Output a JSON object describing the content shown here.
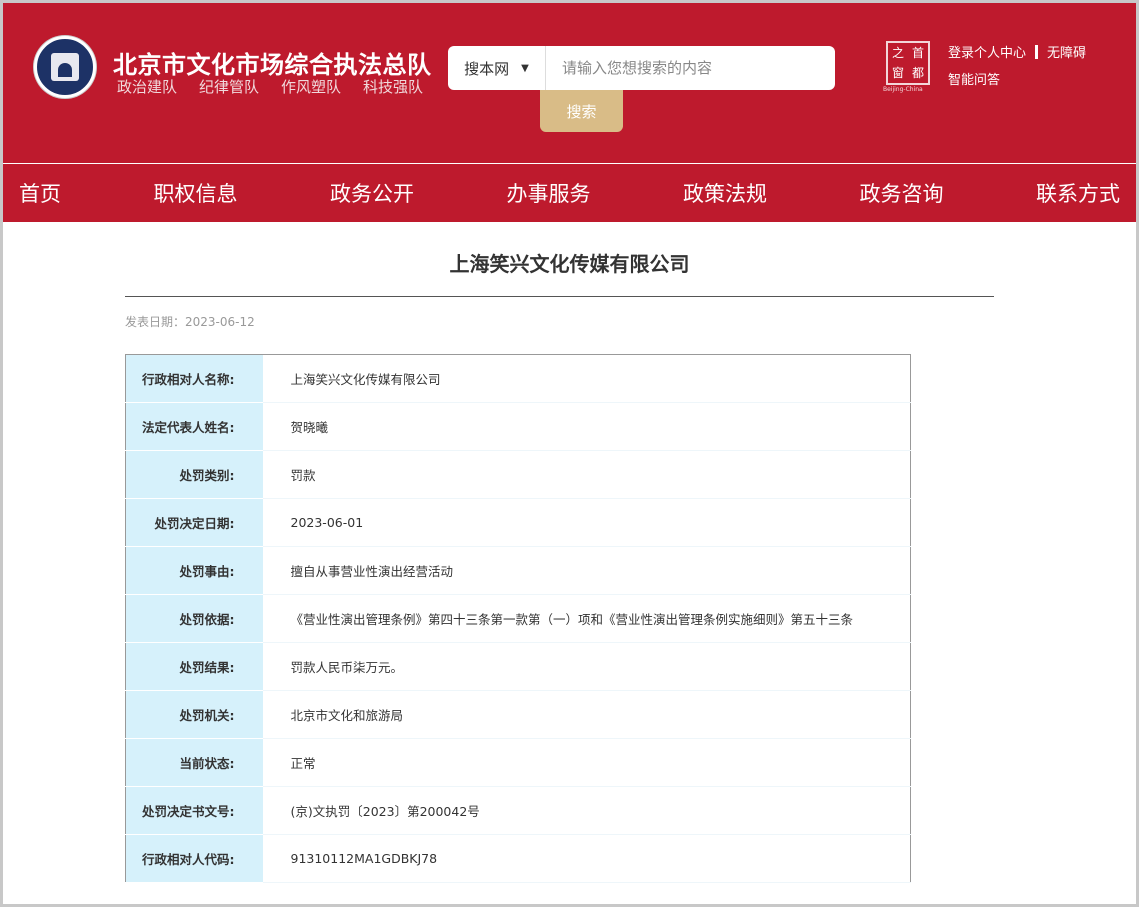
{
  "header": {
    "site_title": "北京市文化市场综合执法总队",
    "slogans": [
      "政治建队",
      "纪律管队",
      "作风塑队",
      "科技强队"
    ],
    "search_scope": "搜本网",
    "search_placeholder": "请输入您想搜索的内容",
    "search_button": "搜索",
    "seal_chars": [
      "之",
      "首",
      "窗",
      "都"
    ],
    "seal_en": "Beijing-China",
    "links": {
      "login": "登录个人中心",
      "accessibility": "无障碍",
      "qa": "智能问答"
    }
  },
  "nav": [
    "首页",
    "职权信息",
    "政务公开",
    "办事服务",
    "政策法规",
    "政务咨询",
    "联系方式"
  ],
  "article": {
    "title": "上海笑兴文化传媒有限公司",
    "date": "发表日期：2023-06-12",
    "rows": [
      {
        "k": "行政相对人名称:",
        "v": "上海笑兴文化传媒有限公司"
      },
      {
        "k": "法定代表人姓名:",
        "v": "贺晓曦"
      },
      {
        "k": "处罚类别:",
        "v": "罚款"
      },
      {
        "k": "处罚决定日期:",
        "v": "2023-06-01"
      },
      {
        "k": "处罚事由:",
        "v": "擅自从事营业性演出经营活动"
      },
      {
        "k": "处罚依据:",
        "v": "《营业性演出管理条例》第四十三条第一款第（一）项和《营业性演出管理条例实施细则》第五十三条"
      },
      {
        "k": "处罚结果:",
        "v": "罚款人民币柒万元。"
      },
      {
        "k": "处罚机关:",
        "v": "北京市文化和旅游局"
      },
      {
        "k": "当前状态:",
        "v": "正常"
      },
      {
        "k": "处罚决定书文号:",
        "v": "(京)文执罚〔2023〕第200042号"
      },
      {
        "k": "行政相对人代码:",
        "v": "91310112MA1GDBKJ78"
      }
    ]
  }
}
